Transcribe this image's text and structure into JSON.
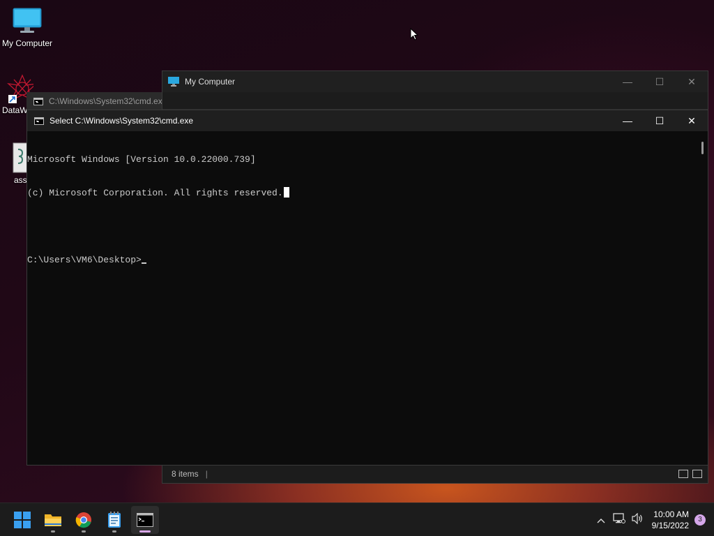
{
  "desktop": {
    "icons": [
      {
        "label": "My Computer"
      },
      {
        "label": "DataW"
      },
      {
        "label": "ass."
      }
    ]
  },
  "explorer": {
    "title": "My Computer",
    "status_items": "8 items",
    "status_sep": "|"
  },
  "cmd_background": {
    "title": "C:\\Windows\\System32\\cmd.ex"
  },
  "cmd": {
    "title": "Select C:\\Windows\\System32\\cmd.exe",
    "lines": [
      "Microsoft Windows [Version 10.0.22000.739]",
      "(c) Microsoft Corporation. All rights reserved.",
      "",
      "C:\\Users\\VM6\\Desktop>"
    ]
  },
  "window_controls": {
    "minimize": "—",
    "maximize": "☐",
    "close": "✕"
  },
  "taskbar": {
    "apps": [
      {
        "name": "start",
        "icon": "windows-start-icon"
      },
      {
        "name": "file-explorer",
        "icon": "folder-icon"
      },
      {
        "name": "chrome",
        "icon": "chrome-icon"
      },
      {
        "name": "notepad",
        "icon": "notepad-icon"
      },
      {
        "name": "cmd",
        "icon": "terminal-icon",
        "active": true
      }
    ],
    "tray": {
      "chevron": "^",
      "time": "10:00 AM",
      "date": "9/15/2022",
      "notifications": "3"
    }
  },
  "colors": {
    "accent": "#d9a8e8",
    "console_text": "#cccccc",
    "console_bg": "#0c0c0c"
  }
}
